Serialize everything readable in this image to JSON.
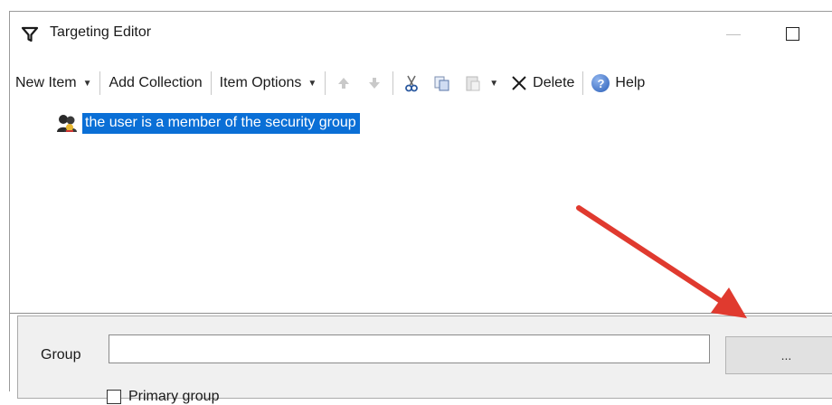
{
  "window": {
    "title": "Targeting Editor"
  },
  "toolbar": {
    "new_item": "New Item",
    "add_collection": "Add Collection",
    "item_options": "Item Options",
    "delete": "Delete",
    "help": "Help"
  },
  "tree": {
    "items": [
      {
        "label": "the user is a member of the security group",
        "icon": "security-group-icon",
        "selected": true
      }
    ]
  },
  "properties": {
    "group_label": "Group",
    "group_value": "",
    "browse_label": "...",
    "primary_group_label": "Primary group",
    "primary_group_checked": false
  },
  "colors": {
    "selection": "#0a6fd6",
    "annotation_arrow": "#e03a2f",
    "panel_bg": "#f0f0f0"
  }
}
